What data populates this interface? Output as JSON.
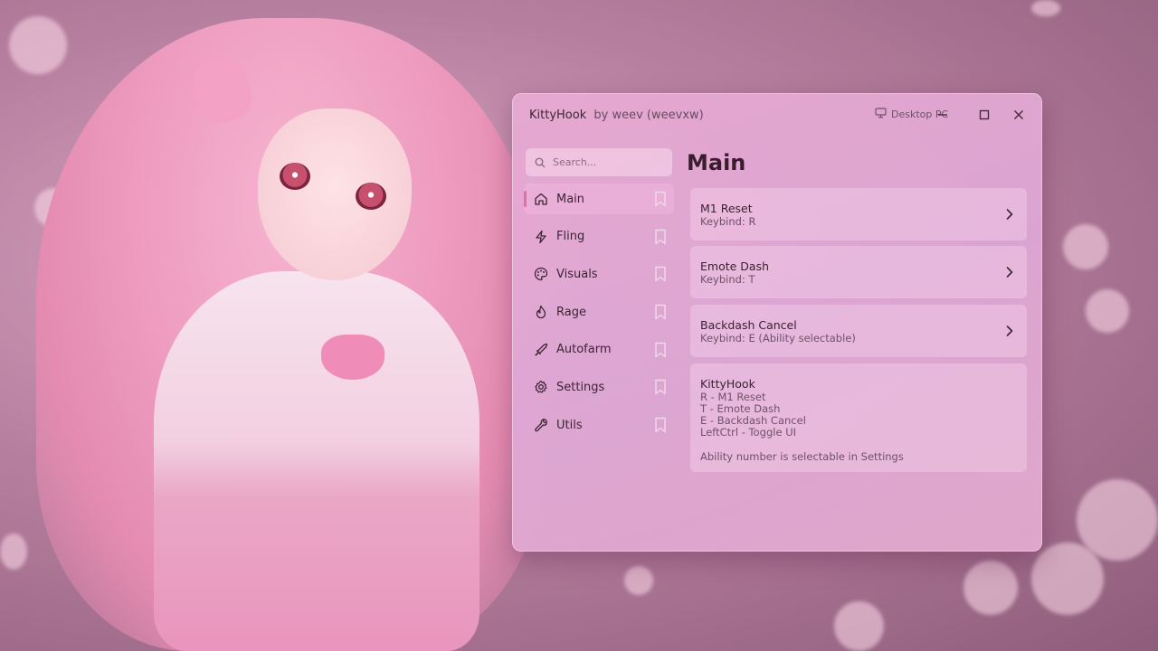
{
  "window": {
    "app_name": "KittyHook",
    "author": "by weev (weevxw)",
    "platform_label": "Desktop PC"
  },
  "search": {
    "placeholder": "Search..."
  },
  "sidebar": {
    "items": [
      {
        "label": "Main",
        "icon": "home-icon",
        "active": true
      },
      {
        "label": "Fling",
        "icon": "lightning-icon",
        "active": false
      },
      {
        "label": "Visuals",
        "icon": "palette-icon",
        "active": false
      },
      {
        "label": "Rage",
        "icon": "flame-icon",
        "active": false
      },
      {
        "label": "Autofarm",
        "icon": "sword-icon",
        "active": false
      },
      {
        "label": "Settings",
        "icon": "gear-icon",
        "active": false
      },
      {
        "label": "Utils",
        "icon": "wrench-icon",
        "active": false
      }
    ]
  },
  "main": {
    "title": "Main",
    "options": [
      {
        "title": "M1 Reset",
        "subtitle": "Keybind: R"
      },
      {
        "title": "Emote Dash",
        "subtitle": "Keybind: T"
      },
      {
        "title": "Backdash Cancel",
        "subtitle": "Keybind: E (Ability selectable)"
      }
    ],
    "info": {
      "title": "KittyHook",
      "lines": [
        "R - M1 Reset",
        "T - Emote Dash",
        "E - Backdash Cancel",
        "LeftCtrl - Toggle UI"
      ],
      "note": "Ability number is selectable in Settings"
    }
  },
  "colors": {
    "accent": "#e0729f",
    "window_bg": "#e3aad2",
    "text_primary": "#3a1f31",
    "text_secondary": "#6e5166"
  }
}
